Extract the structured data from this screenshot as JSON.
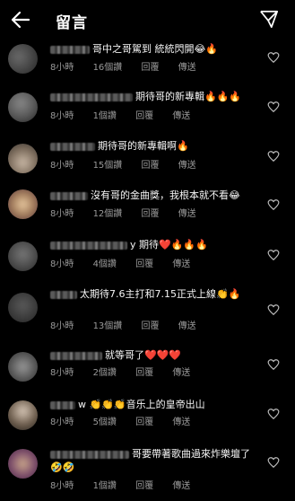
{
  "header": {
    "title": "留言"
  },
  "labels": {
    "reply": "回覆",
    "send": "傳送"
  },
  "comments": [
    {
      "text": "哥中之哥駕到 統統閃開😂🔥",
      "time": "8小時",
      "likes": "16個讚"
    },
    {
      "text": "期待哥的新專輯🔥🔥🔥",
      "time": "8小時",
      "likes": "1個讚"
    },
    {
      "text": "期待哥的新專輯啊🔥",
      "time": "8小時",
      "likes": "15個讚"
    },
    {
      "text": "沒有哥的金曲獎，我根本就不看😂",
      "time": "8小時",
      "likes": "12個讚"
    },
    {
      "text": "y 期待❤️🔥🔥🔥",
      "time": "8小時",
      "likes": "4個讚"
    },
    {
      "text": "太期待7.6主打和7.15正式上線👏🔥",
      "time": "8小時",
      "likes": "13個讚"
    },
    {
      "text": "就等哥了❤️❤️❤️",
      "time": "8小時",
      "likes": "2個讚"
    },
    {
      "text": "w 👏👏👏音乐上的皇帝出山",
      "time": "8小時",
      "likes": "5個讚"
    },
    {
      "text": "哥要帶著歌曲過來炸樂壇了🤣🤣",
      "time": "8小時",
      "likes": "1個讚"
    }
  ],
  "colors": {
    "background": "#000000",
    "meta": "#9a9a9a",
    "text": "#f5f5f5"
  },
  "icons": {
    "back": "arrow-left-icon",
    "share": "paper-plane-icon",
    "like": "heart-outline-icon"
  }
}
